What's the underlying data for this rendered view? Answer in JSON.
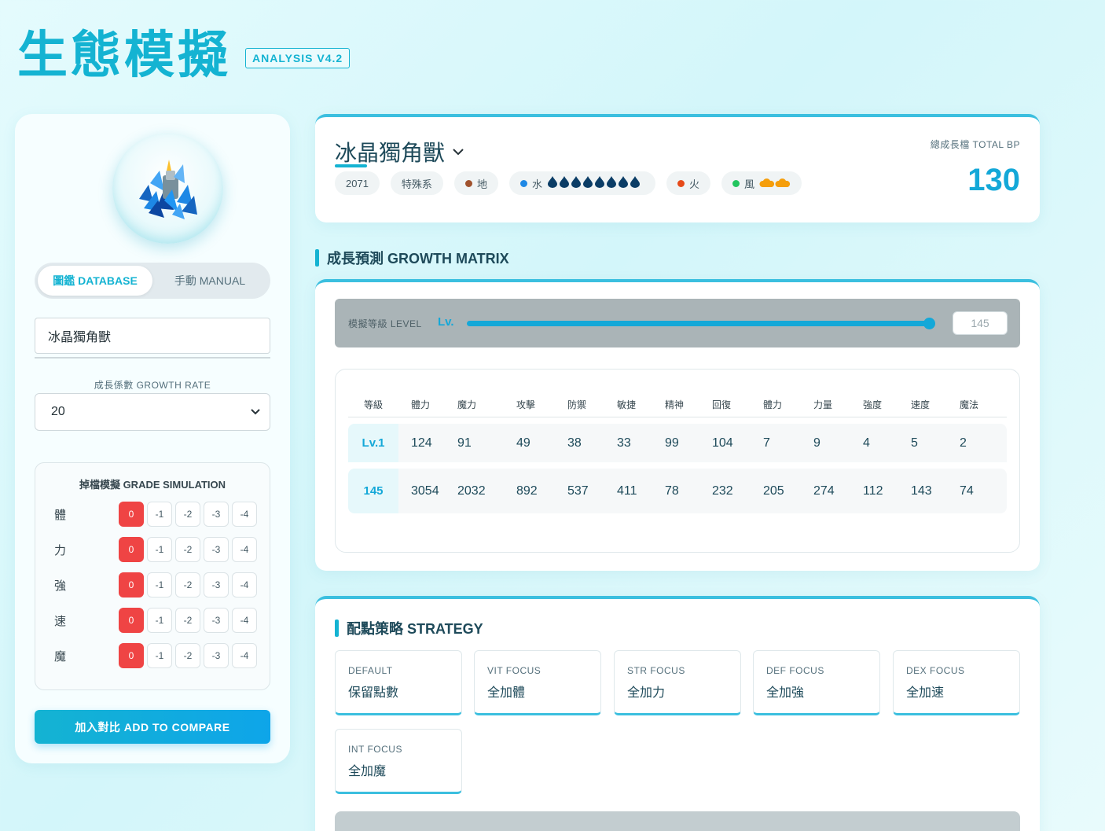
{
  "header": {
    "title": "生態模擬",
    "version": "ANALYSIS V4.2"
  },
  "sidebar": {
    "mode_tabs": [
      {
        "label": "圖鑑 DATABASE",
        "active": true
      },
      {
        "label": "手動 MANUAL",
        "active": false
      }
    ],
    "name_input_value": "冰晶獨角獸",
    "growth_rate_label": "成長係數 GROWTH RATE",
    "growth_rate_value": "20",
    "grade_title": "掉檔模擬 GRADE SIMULATION",
    "grade_rows": [
      {
        "label": "體",
        "options": [
          "0",
          "-1",
          "-2",
          "-3",
          "-4"
        ],
        "selected": "0"
      },
      {
        "label": "力",
        "options": [
          "0",
          "-1",
          "-2",
          "-3",
          "-4"
        ],
        "selected": "0"
      },
      {
        "label": "強",
        "options": [
          "0",
          "-1",
          "-2",
          "-3",
          "-4"
        ],
        "selected": "0"
      },
      {
        "label": "速",
        "options": [
          "0",
          "-1",
          "-2",
          "-3",
          "-4"
        ],
        "selected": "0"
      },
      {
        "label": "魔",
        "options": [
          "0",
          "-1",
          "-2",
          "-3",
          "-4"
        ],
        "selected": "0"
      }
    ],
    "compare_button": "加入對比 ADD TO COMPARE"
  },
  "species": {
    "name": "冰晶獨角獸",
    "tags": {
      "id": "2071",
      "type": "特殊系"
    },
    "elements": [
      {
        "name": "地",
        "color": "#a0522d",
        "icons": ""
      },
      {
        "name": "水",
        "color": "#1e88e5",
        "icons": "💧💧💧💧💧💧💧💧"
      },
      {
        "name": "火",
        "color": "#e64a19",
        "icons": ""
      },
      {
        "name": "風",
        "color": "#22c55e",
        "icons": "☁☁"
      }
    ],
    "bp_label": "總成長檔 TOTAL BP",
    "bp_value": "130"
  },
  "growth": {
    "heading": "成長預測 GROWTH MATRIX",
    "level_label": "模擬等級 LEVEL",
    "lv_prefix": "Lv.",
    "level_value": "145",
    "level_fill_fraction": 0.99,
    "columns": [
      "等級",
      "體力",
      "魔力",
      "攻擊",
      "防禦",
      "敏捷",
      "精神",
      "回復",
      "體力",
      "力量",
      "強度",
      "速度",
      "魔法"
    ],
    "rows": [
      [
        "Lv.1",
        "124",
        "91",
        "49",
        "38",
        "33",
        "99",
        "104",
        "7",
        "9",
        "4",
        "5",
        "2"
      ],
      [
        "145",
        "3054",
        "2032",
        "892",
        "537",
        "411",
        "78",
        "232",
        "205",
        "274",
        "112",
        "143",
        "74"
      ]
    ]
  },
  "strategy": {
    "heading": "配點策略 STRATEGY",
    "items": [
      {
        "en": "DEFAULT",
        "zh": "保留點數"
      },
      {
        "en": "VIT FOCUS",
        "zh": "全加體"
      },
      {
        "en": "STR FOCUS",
        "zh": "全加力"
      },
      {
        "en": "DEF FOCUS",
        "zh": "全加強"
      },
      {
        "en": "DEX FOCUS",
        "zh": "全加速"
      },
      {
        "en": "INT FOCUS",
        "zh": "全加魔"
      }
    ]
  },
  "colors": {
    "accent": "#14b3d2",
    "active_grade": "#ef4444"
  }
}
